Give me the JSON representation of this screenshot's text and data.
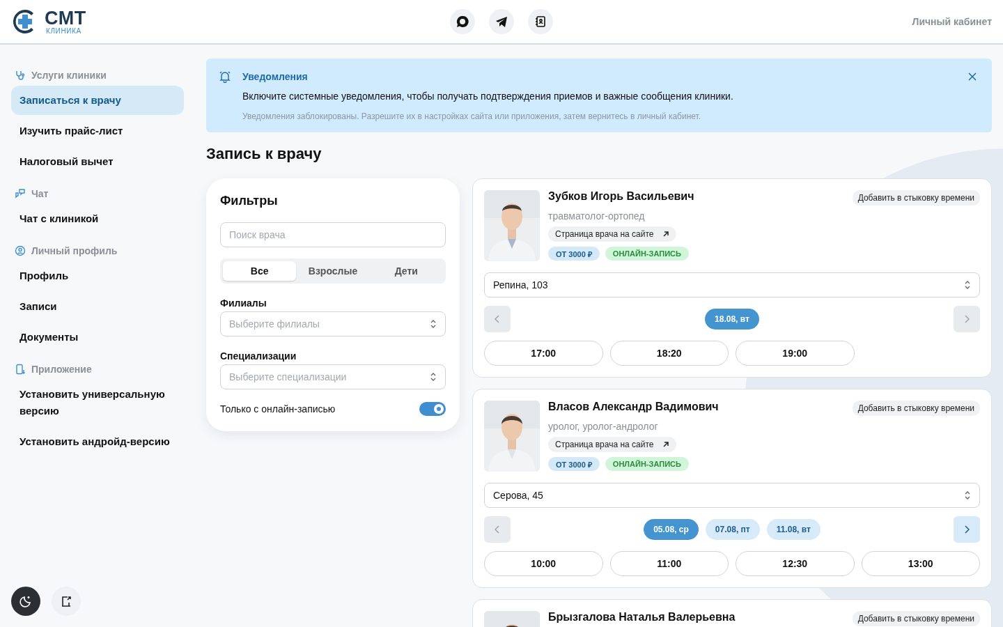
{
  "header": {
    "logo_title": "СМТ",
    "logo_subtitle": "КЛИНИКА",
    "account_link": "Личный кабинет"
  },
  "sidebar": {
    "sections": [
      {
        "title": "Услуги клиники",
        "items": [
          {
            "label": "Записаться к врачу",
            "selected": true
          },
          {
            "label": "Изучить прайс-лист",
            "selected": false
          },
          {
            "label": "Налоговый вычет",
            "selected": false
          }
        ]
      },
      {
        "title": "Чат",
        "items": [
          {
            "label": "Чат с клиникой",
            "selected": false
          }
        ]
      },
      {
        "title": "Личный профиль",
        "items": [
          {
            "label": "Профиль",
            "selected": false
          },
          {
            "label": "Записи",
            "selected": false
          },
          {
            "label": "Документы",
            "selected": false
          }
        ]
      },
      {
        "title": "Приложение",
        "items": [
          {
            "label": "Установить универсальную версию",
            "selected": false
          },
          {
            "label": "Установить андройд-версию",
            "selected": false
          }
        ]
      }
    ]
  },
  "notification": {
    "title": "Уведомления",
    "message": "Включите системные уведомления, чтобы получать подтверждения приемов и важные сообщения клиники.",
    "note": "Уведомления заблокированы. Разрешите их в настройках сайта или приложения, затем вернитесь в личный кабинет."
  },
  "page_title": "Запись к врачу",
  "filters": {
    "title": "Фильтры",
    "search_placeholder": "Поиск врача",
    "age_tabs": [
      {
        "label": "Все",
        "selected": true
      },
      {
        "label": "Взрослые",
        "selected": false
      },
      {
        "label": "Дети",
        "selected": false
      }
    ],
    "branches_label": "Филиалы",
    "branches_placeholder": "Выберите филиалы",
    "specializations_label": "Специализации",
    "specializations_placeholder": "Выберите специализации",
    "online_only_label": "Только с онлайн-записью",
    "online_only": true
  },
  "doctors": [
    {
      "name": "Зубков Игорь Васильевич",
      "specialty": "травматолог-ортопед",
      "add_button": "Добавить в стыковку времени",
      "site_link": "Страница врача на сайте",
      "price": "ОТ 3000 ₽",
      "online_badge": "ОНЛАЙН-ЗАПИСЬ",
      "branch": "Репина, 103",
      "prev_enabled": false,
      "next_enabled": false,
      "dates": [
        {
          "label": "18.08, вт",
          "selected": true
        }
      ],
      "times": [
        "17:00",
        "18:20",
        "19:00"
      ]
    },
    {
      "name": "Власов Александр Вадимович",
      "specialty": "уролог, уролог-андролог",
      "add_button": "Добавить в стыковку времени",
      "site_link": "Страница врача на сайте",
      "price": "ОТ 3000 ₽",
      "online_badge": "ОНЛАЙН-ЗАПИСЬ",
      "branch": "Серова, 45",
      "prev_enabled": false,
      "next_enabled": true,
      "dates": [
        {
          "label": "05.08, ср",
          "selected": true
        },
        {
          "label": "07.08, пт",
          "selected": false
        },
        {
          "label": "11.08, вт",
          "selected": false
        }
      ],
      "times": [
        "10:00",
        "11:00",
        "12:30",
        "13:00"
      ]
    },
    {
      "name": "Брызгалова Наталья Валерьевна",
      "add_button": "Добавить в стыковку времени"
    }
  ]
}
